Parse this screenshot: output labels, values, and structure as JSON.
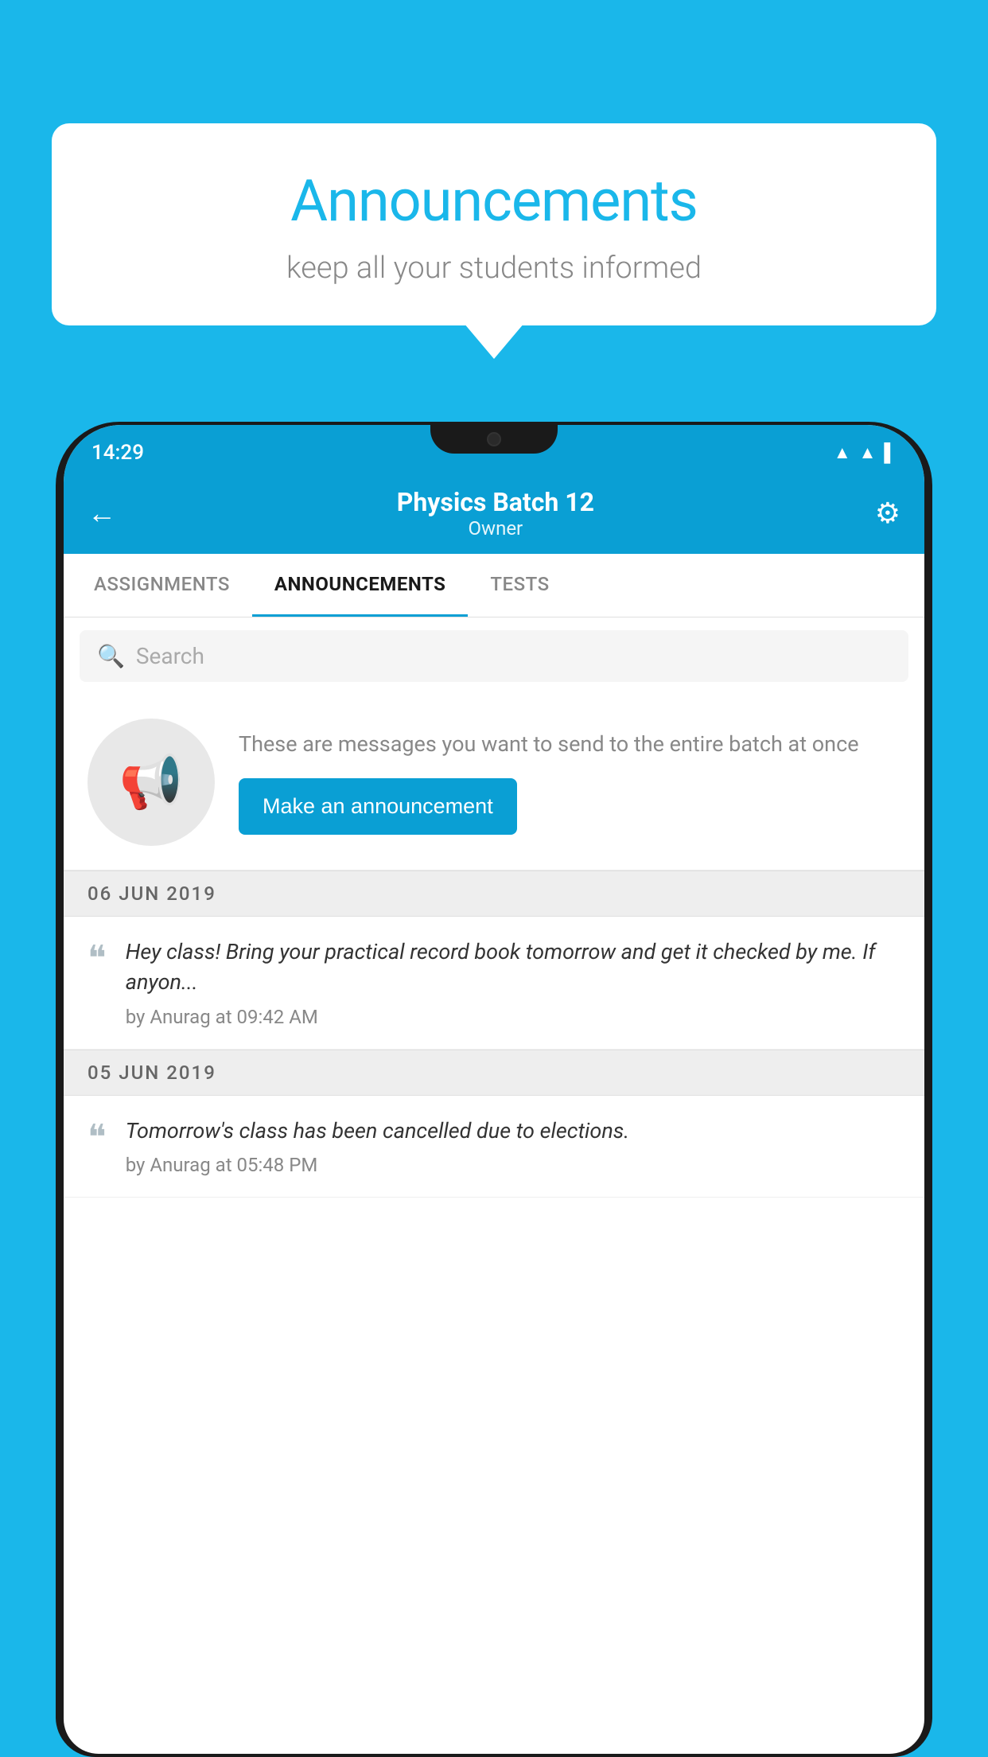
{
  "background_color": "#1ab7ea",
  "speech_bubble": {
    "title": "Announcements",
    "subtitle": "keep all your students informed"
  },
  "status_bar": {
    "time": "14:29",
    "icons": [
      "wifi",
      "signal",
      "battery"
    ]
  },
  "app_header": {
    "back_label": "←",
    "title": "Physics Batch 12",
    "subtitle": "Owner",
    "gear_label": "⚙"
  },
  "tabs": [
    {
      "label": "ASSIGNMENTS",
      "active": false
    },
    {
      "label": "ANNOUNCEMENTS",
      "active": true
    },
    {
      "label": "TESTS",
      "active": false
    }
  ],
  "search": {
    "placeholder": "Search"
  },
  "empty_state": {
    "description": "These are messages you want to send to the entire batch at once",
    "button_label": "Make an announcement"
  },
  "announcements": [
    {
      "date_separator": "06  JUN  2019",
      "text": "Hey class! Bring your practical record book tomorrow and get it checked by me. If anyon...",
      "meta": "by Anurag at 09:42 AM"
    },
    {
      "date_separator": "05  JUN  2019",
      "text": "Tomorrow's class has been cancelled due to elections.",
      "meta": "by Anurag at 05:48 PM"
    }
  ]
}
